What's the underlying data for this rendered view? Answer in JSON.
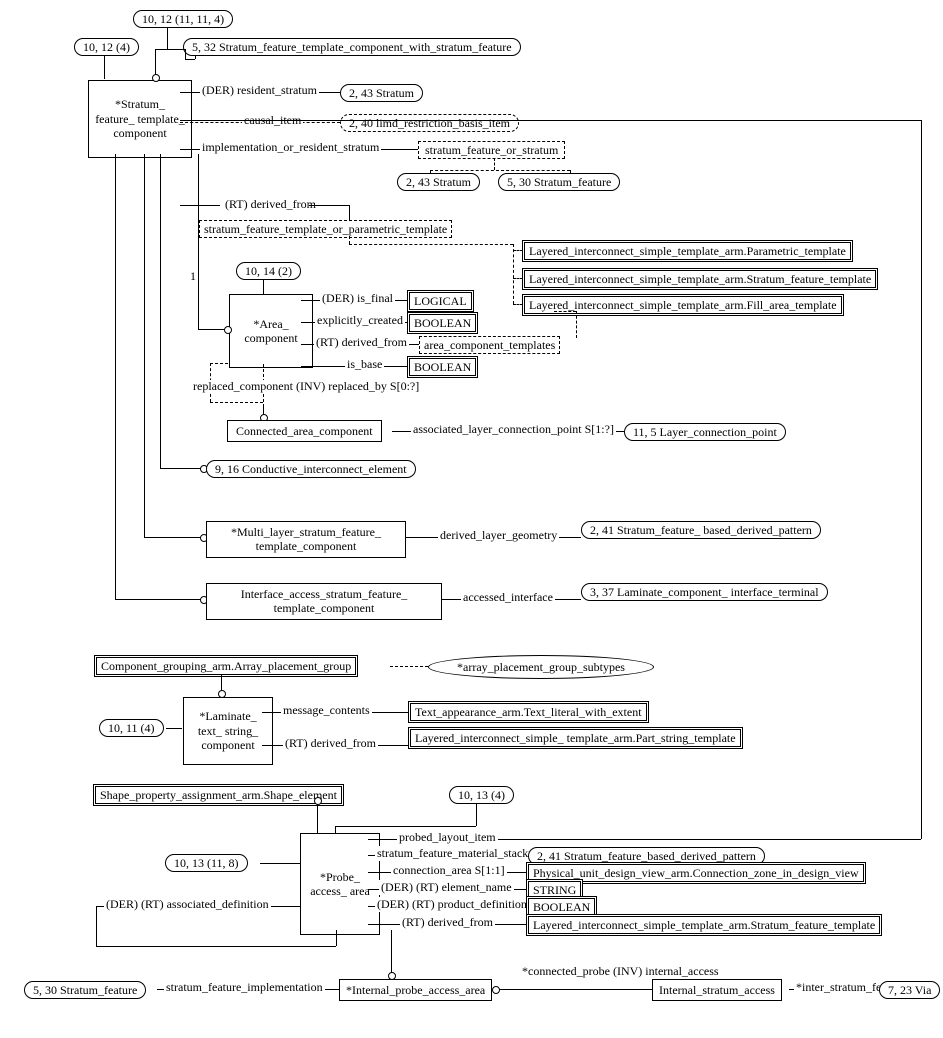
{
  "refs": {
    "r1": "10, 12 (11, 11, 4)",
    "r2": "10, 12 (4)",
    "r3": "5, 32 Stratum_feature_template_component_with_stratum_feature",
    "r4": "2, 43 Stratum",
    "r5": "2, 40 limd_restriction_basis_item",
    "r6": "2, 43 Stratum",
    "r7": "5, 30 Stratum_feature",
    "r8": "10, 14 (2)",
    "r9": "11, 5 Layer_connection_point",
    "r10": "9, 16 Conductive_interconnect_element",
    "r11": "2, 41 Stratum_feature_ based_derived_pattern",
    "r12": "3, 37 Laminate_component_ interface_terminal",
    "r13": "10, 11 (4)",
    "r14": "10, 13 (4)",
    "r15": "10, 13 (11, 8)",
    "r16": "2, 41 Stratum_feature_based_derived_pattern",
    "r17": "5, 30 Stratum_feature",
    "r18": "7, 23 Via"
  },
  "entities": {
    "e1": "*Stratum_ feature_ template_ component",
    "e2": "*Area_ component",
    "e3": "Connected_area_component",
    "e4": "*Multi_layer_stratum_feature_ template_component",
    "e5": "Interface_access_stratum_feature_ template_component",
    "e6": "*Laminate_ text_ string_ component",
    "e7": "*Probe_ access_ area",
    "e8": "*Internal_probe_access_area",
    "e9": "Internal_stratum_access"
  },
  "types": {
    "t1": "LOGICAL",
    "t2": "BOOLEAN",
    "t3": "BOOLEAN",
    "t4": "STRING",
    "t5": "BOOLEAN"
  },
  "selects": {
    "s1": "stratum_feature_or_stratum",
    "s2": "stratum_feature_template_or_parametric_template",
    "s3": "area_component_templates",
    "s4": "*array_placement_group_subtypes"
  },
  "ext": {
    "x1": "Layered_interconnect_simple_template_arm.Parametric_template",
    "x2": "Layered_interconnect_simple_template_arm.Stratum_feature_template",
    "x3": "Layered_interconnect_simple_template_arm.Fill_area_template",
    "x4": "Component_grouping_arm.Array_placement_group",
    "x5": "Text_appearance_arm.Text_literal_with_extent",
    "x6": "Layered_interconnect_simple_ template_arm.Part_string_template",
    "x7": "Shape_property_assignment_arm.Shape_element",
    "x8": "Physical_unit_design_view_arm.Connection_zone_in_design_view",
    "x9": "Layered_interconnect_simple_template_arm.Stratum_feature_template"
  },
  "labels": {
    "l1": "(DER) resident_stratum",
    "l2": "causal_item",
    "l3": "implementation_or_resident_stratum",
    "l4": "(RT) derived_from",
    "l5": "(DER) is_final",
    "l6": "explicitly_created",
    "l7": "(RT) derived_from",
    "l8": "is_base",
    "l9": "replaced_component (INV) replaced_by S[0:?]",
    "l10": "associated_layer_connection_point S[1:?]",
    "l11": "derived_layer_geometry",
    "l12": "accessed_interface",
    "l13": "message_contents",
    "l14": "(RT) derived_from",
    "l15": "probed_layout_item",
    "l16": "stratum_feature_material_stackup",
    "l17": "connection_area S[1:1]",
    "l18": "(DER) (RT) element_name",
    "l19": "(DER) (RT) product_definitional",
    "l20": "(RT) derived_from",
    "l21": "(DER) (RT) associated_definition",
    "l22": "stratum_feature_implementation",
    "l23": "*connected_probe (INV) internal_access",
    "l24": "*inter_stratum_feature",
    "l25": "1"
  }
}
